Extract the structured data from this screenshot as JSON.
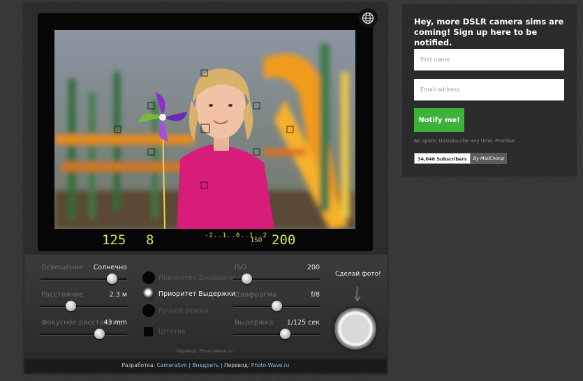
{
  "viewfinder": {
    "shutter_speed": "125",
    "aperture": "8",
    "exposure_scale": "-2..1..0..1..2",
    "iso_label": "ISO",
    "iso": "200"
  },
  "settings": {
    "lighting": {
      "label": "Освещение",
      "value": "Солнечно",
      "level": 0.82
    },
    "distance": {
      "label": "Расстояние",
      "value": "2.3 м",
      "level": 0.35
    },
    "focal": {
      "label": "Фокусное расстояние",
      "value": "43 mm",
      "level": 0.68
    },
    "iso": {
      "label": "ISO",
      "value": "200",
      "level": 0.15
    },
    "aperture": {
      "label": "Диафрагма",
      "value": "f/8",
      "level": 0.5
    },
    "shutter": {
      "label": "Выдержка",
      "value": "1/125 сек",
      "level": 0.6
    }
  },
  "modes": [
    {
      "label": "Приоритет Диафрагмы",
      "selected": false
    },
    {
      "label": "Приоритет Выдержки",
      "selected": true
    },
    {
      "label": "Ручной режим",
      "selected": false
    }
  ],
  "tripod_label": "Штатив",
  "take_photo_label": "Сделай фото!",
  "translation_credit": "Перевод: Photo-Wave.ru",
  "footer": {
    "developed_label": "Разработка:",
    "developed_link": "CameraSim",
    "sep1": "|",
    "embed_link": "Внедрить",
    "sep2": "|",
    "translation_label": "Перевод:",
    "translation_link": "Photo-Wave.ru"
  },
  "signup": {
    "heading": "Hey, more DSLR camera sims are coming! Sign up here to be notified.",
    "first_name_placeholder": "First name",
    "email_placeholder": "Email address",
    "notify_label": "Notify me!",
    "disclaimer": "No spam. Unsubscribe any time. Promise.",
    "subscribers": "34,648 Subscribers",
    "mailchimp": "By MailChimp"
  },
  "colors": {
    "lcd_green": "#c8f04a",
    "notify_green": "#3db23a",
    "link_blue": "#8fb8ea"
  }
}
